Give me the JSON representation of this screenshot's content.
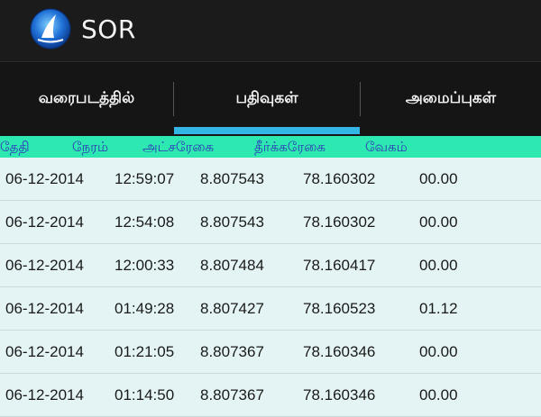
{
  "app": {
    "title": "SOR",
    "icon": "sailboat-logo-icon"
  },
  "tabs": [
    {
      "label": "வரைபடத்தில்",
      "selected": false
    },
    {
      "label": "பதிவுகள்",
      "selected": true
    },
    {
      "label": "அமைப்புகள்",
      "selected": false
    }
  ],
  "colors": {
    "actionbar": "#1b1b1b",
    "tabbar": "#151515",
    "tab_indicator": "#33b5e5",
    "table_header_bg": "#2de8b0",
    "table_header_text": "#2f3ab8",
    "row_bg": "#e4f4f4"
  },
  "table": {
    "columns": [
      "தேதி",
      "நேரம்",
      "அட்சரேகை",
      "தீர்க்கரேகை",
      "வேகம்"
    ],
    "rows": [
      [
        "06-12-2014",
        "12:59:07",
        "8.807543",
        "78.160302",
        "00.00"
      ],
      [
        "06-12-2014",
        "12:54:08",
        "8.807543",
        "78.160302",
        "00.00"
      ],
      [
        "06-12-2014",
        "12:00:33",
        "8.807484",
        "78.160417",
        "00.00"
      ],
      [
        "06-12-2014",
        "01:49:28",
        "8.807427",
        "78.160523",
        "01.12"
      ],
      [
        "06-12-2014",
        "01:21:05",
        "8.807367",
        "78.160346",
        "00.00"
      ],
      [
        "06-12-2014",
        "01:14:50",
        "8.807367",
        "78.160346",
        "00.00"
      ]
    ]
  }
}
